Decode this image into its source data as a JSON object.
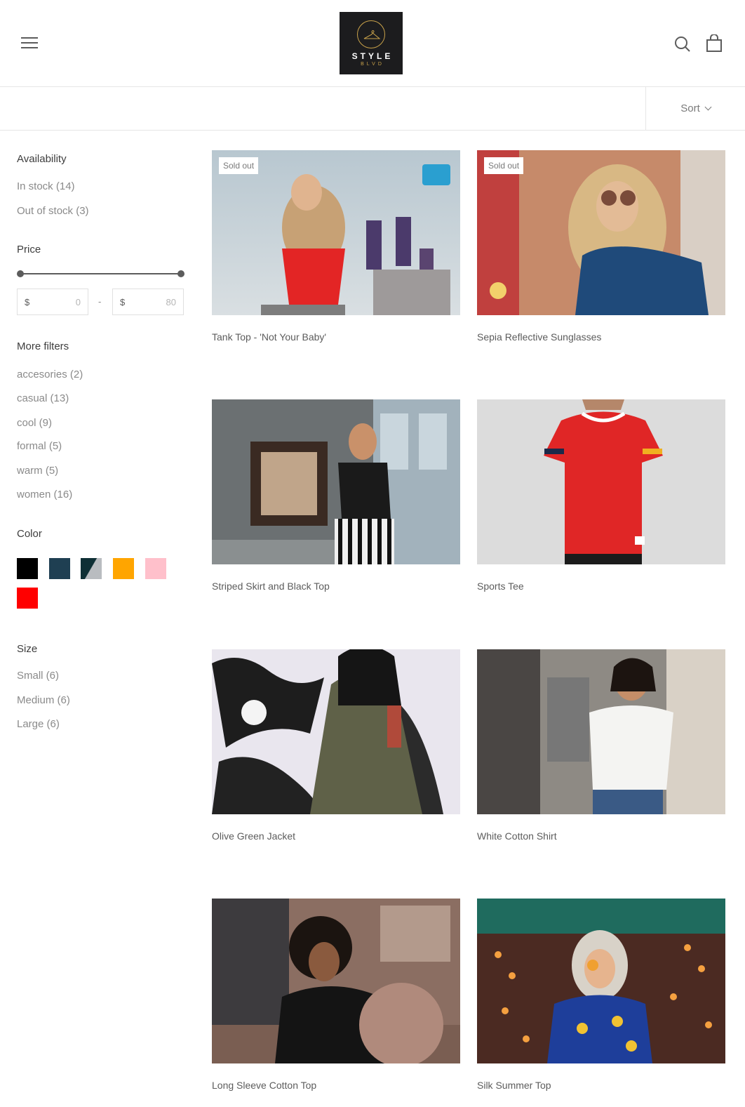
{
  "header": {
    "logo_text": "STYLE",
    "logo_subtext": "BLVD"
  },
  "toolbar": {
    "sort_label": "Sort"
  },
  "filters": {
    "availability": {
      "title": "Availability",
      "items": [
        "In stock (14)",
        "Out of stock (3)"
      ]
    },
    "price": {
      "title": "Price",
      "currency": "$",
      "min_value": "0",
      "max_value": "80",
      "separator": "-"
    },
    "more_filters": {
      "title": "More filters",
      "items": [
        "accesories (2)",
        "casual (13)",
        "cool (9)",
        "formal (5)",
        "warm (5)",
        "women (16)"
      ]
    },
    "color": {
      "title": "Color",
      "swatches": [
        "#000000",
        "#1f3f52",
        "split-denim-gray",
        "#ffa500",
        "#ffc0cb",
        "#ff0000"
      ]
    },
    "size": {
      "title": "Size",
      "items": [
        "Small (6)",
        "Medium (6)",
        "Large (6)"
      ]
    }
  },
  "products": [
    {
      "title": "Tank Top - 'Not Your Baby'",
      "badge": "Sold out"
    },
    {
      "title": "Sepia Reflective Sunglasses",
      "badge": "Sold out"
    },
    {
      "title": "Striped Skirt and Black Top",
      "badge": ""
    },
    {
      "title": "Sports Tee",
      "badge": ""
    },
    {
      "title": "Olive Green Jacket",
      "badge": ""
    },
    {
      "title": "White Cotton Shirt",
      "badge": ""
    },
    {
      "title": "Long Sleeve Cotton Top",
      "badge": ""
    },
    {
      "title": "Silk Summer Top",
      "badge": ""
    }
  ]
}
